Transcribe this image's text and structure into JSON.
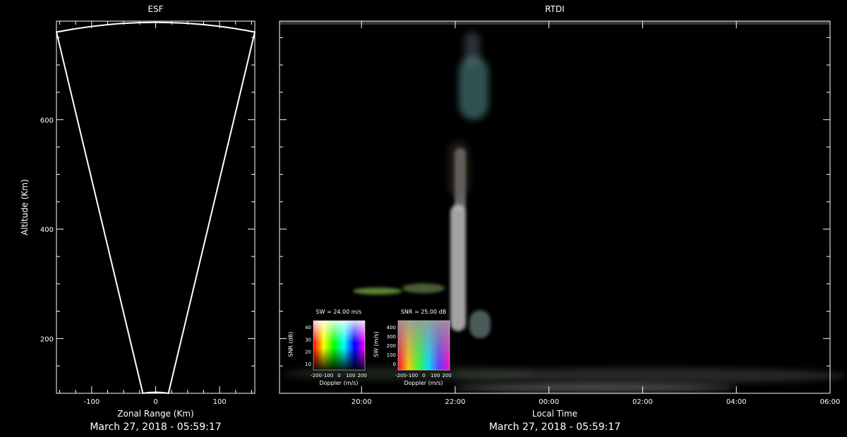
{
  "chart_data": [
    {
      "type": "diagram",
      "title": "ESF",
      "xlabel": "Zonal Range (Km)",
      "ylabel": "Altitude (Km)",
      "xlim": [
        -155,
        155
      ],
      "ylim": [
        100,
        780
      ],
      "xticks": [
        -100,
        0,
        100
      ],
      "yticks": [
        200,
        400,
        600
      ],
      "footer": "March 27, 2018 - 05:59:17",
      "fan": {
        "min_range_km": 100,
        "max_range_km": 780,
        "bottom_half_width_km": 20,
        "top_half_width_km": 155
      }
    },
    {
      "type": "heatmap",
      "title": "RTDI",
      "xlabel": "Local Time",
      "x": [
        "20:00",
        "22:00",
        "00:00",
        "02:00",
        "04:00",
        "06:00"
      ],
      "xlim": [
        "18:15",
        "06:00"
      ],
      "ylim": [
        100,
        780
      ],
      "footer": "March 27, 2018 - 05:59:17",
      "colorbars": [
        {
          "title": "SW = 24.00 m/s",
          "xlabel": "Doppler (m/s)",
          "ylabel": "SNR (dB)",
          "xticks": [
            "-200",
            "-100",
            "0",
            "100",
            "200"
          ],
          "yticks": [
            "10",
            "20",
            "30",
            "40"
          ]
        },
        {
          "title": "SNR = 25.00 dB",
          "xlabel": "Doppler (m/s)",
          "ylabel": "SW (m/s)",
          "xticks": [
            "-200",
            "-100",
            "0",
            "100",
            "200"
          ],
          "yticks": [
            "0",
            "100",
            "200",
            "300",
            "400"
          ]
        }
      ]
    }
  ]
}
